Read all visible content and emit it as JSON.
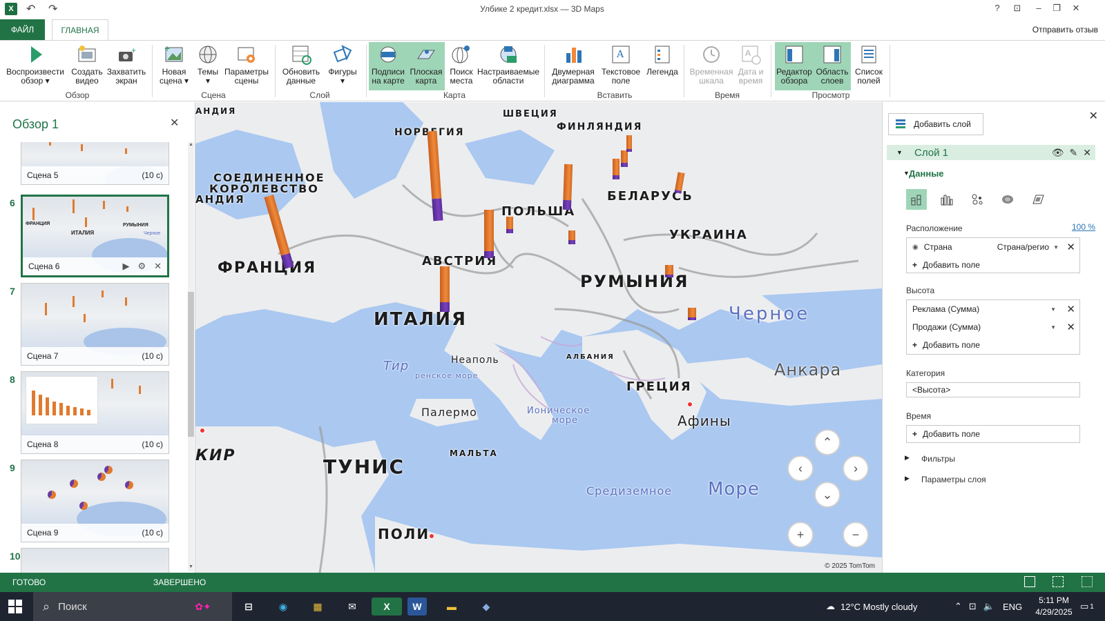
{
  "window": {
    "title": "Улбике 2 кредит.xlsx — 3D Maps",
    "app_logo": "X",
    "help": "?",
    "ribbon_options": "⊡",
    "minimize": "–",
    "restore": "❐",
    "close": "✕"
  },
  "tabs": {
    "file": "ФАЙЛ",
    "home": "ГЛАВНАЯ",
    "feedback": "Отправить отзыв"
  },
  "ribbon": {
    "buttons": [
      {
        "l1": "Воспроизвести",
        "l2": "обзор ▾"
      },
      {
        "l1": "Создать",
        "l2": "видео"
      },
      {
        "l1": "Захватить",
        "l2": "экран"
      },
      {
        "l1": "Новая",
        "l2": "сцена ▾"
      },
      {
        "l1": "Темы",
        "l2": "▾"
      },
      {
        "l1": "Параметры",
        "l2": "сцены"
      },
      {
        "l1": "Обновить",
        "l2": "данные"
      },
      {
        "l1": "Фигуры",
        "l2": "▾"
      },
      {
        "l1": "Подписи",
        "l2": "на карте"
      },
      {
        "l1": "Плоская",
        "l2": "карта"
      },
      {
        "l1": "Поиск",
        "l2": "места"
      },
      {
        "l1": "Настраиваемые",
        "l2": "области"
      },
      {
        "l1": "Двумерная",
        "l2": "диаграмма"
      },
      {
        "l1": "Текстовое",
        "l2": "поле"
      },
      {
        "l1": "Легенда",
        "l2": ""
      },
      {
        "l1": "Временная",
        "l2": "шкала"
      },
      {
        "l1": "Дата и",
        "l2": "время"
      },
      {
        "l1": "Редактор",
        "l2": "обзора"
      },
      {
        "l1": "Область",
        "l2": "слоев"
      },
      {
        "l1": "Список",
        "l2": "полей"
      }
    ],
    "groups": [
      "Обзор",
      "Сцена",
      "Слой",
      "Карта",
      "Вставить",
      "Время",
      "Просмотр"
    ]
  },
  "tour": {
    "title": "Обзор 1",
    "close": "✕",
    "scenes": [
      {
        "num": "",
        "name": "Сцена 5",
        "dur": "(10 с)"
      },
      {
        "num": "6",
        "name": "Сцена 6",
        "dur": ""
      },
      {
        "num": "7",
        "name": "Сцена 7",
        "dur": "(10 с)"
      },
      {
        "num": "8",
        "name": "Сцена 8",
        "dur": "(10 с)"
      },
      {
        "num": "9",
        "name": "Сцена 9",
        "dur": "(10 с)"
      },
      {
        "num": "10",
        "name": "",
        "dur": ""
      }
    ],
    "scene6_mini_labels": [
      "ФРАНЦИЯ",
      "ИТАЛИЯ",
      "РУМЫНИЯ",
      "Черное"
    ],
    "scroll_up": "▲",
    "scroll_down": "▼"
  },
  "map": {
    "countries": [
      "ШВЕЦИЯ",
      "ФИНЛЯНДИЯ",
      "НОРВЕГИЯ",
      "СОЕДИНЕННОЕ",
      "КОРОЛЕВСТВО",
      "ПОЛЬША",
      "БЕЛАРУСЬ",
      "УКРАИНА",
      "ФРАНЦИЯ",
      "АВСТРИЯ",
      "РУМЫНИЯ",
      "ИТАЛИЯ",
      "ГРЕЦИЯ",
      "ТУНИС",
      "АНДИЯ",
      "АНДИЯ",
      "МАЛЬТА",
      "АЛБАНИЯ",
      "КИР",
      "ПОЛИ"
    ],
    "cities": [
      "Неаполь",
      "Палермо",
      "Афины",
      "Анкара"
    ],
    "seas": [
      "Черное",
      "Тир",
      "ренское море",
      "Ионическое",
      "море",
      "Средиземное",
      "Море"
    ],
    "copyright": "© 2025 TomTom",
    "nav": {
      "up": "⌃",
      "down": "⌄",
      "left": "‹",
      "right": "›",
      "zoom_in": "+",
      "zoom_out": "−"
    }
  },
  "layer_pane": {
    "add_layer": "Добавить слой",
    "layer_name": "Слой 1",
    "data_section": "Данные",
    "location_label": "Расположение",
    "location_pct": "100 %",
    "location_field": "Страна",
    "location_type": "Страна/регио",
    "add_field": "Добавить поле",
    "height_label": "Высота",
    "height_fields": [
      "Реклама (Сумма)",
      "Продажи (Сумма)"
    ],
    "category_label": "Категория",
    "category_value": "<Высота>",
    "time_label": "Время",
    "filters": "Фильтры",
    "layer_options": "Параметры слоя"
  },
  "statusbar": {
    "ready": "ГОТОВО",
    "done": "ЗАВЕРШЕНО"
  },
  "taskbar": {
    "search": "Поиск",
    "weather": "12°C  Mostly cloudy",
    "lang": "ENG",
    "time": "5:11 PM",
    "date": "4/29/2025",
    "notif_badge": "1"
  },
  "colors": {
    "accent": "#217346",
    "bar_orange": "#e07a2e",
    "bar_purple": "#6b3aa6",
    "sea": "#aac8f0",
    "land": "#ecedef"
  }
}
